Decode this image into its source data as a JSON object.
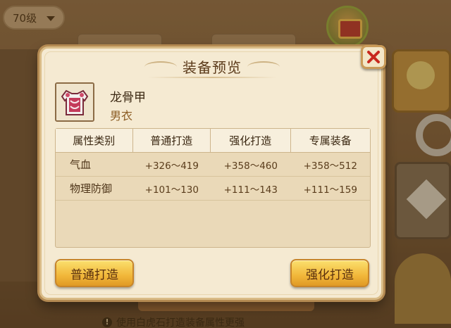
{
  "background": {
    "level_select": "70级",
    "footer_text": "使用白虎石打造装备属性更强"
  },
  "dialog": {
    "title": "装备预览",
    "close_icon": "close-x-icon",
    "item": {
      "name": "龙骨甲",
      "type": "男衣",
      "icon": "armor-icon"
    },
    "table": {
      "headers": [
        "属性类别",
        "普通打造",
        "强化打造",
        "专属装备"
      ],
      "rows": [
        {
          "label": "气血",
          "values": [
            "+326～419",
            "+358～460",
            "+358～512"
          ]
        },
        {
          "label": "物理防御",
          "values": [
            "+101～130",
            "+111～143",
            "+111～159"
          ]
        }
      ]
    },
    "buttons": {
      "normal_forge": "普通打造",
      "enhanced_forge": "强化打造"
    }
  },
  "colors": {
    "dialog_bg": "#f5ead2",
    "button_gold": "#f1b73a",
    "close_red": "#c8281e"
  }
}
